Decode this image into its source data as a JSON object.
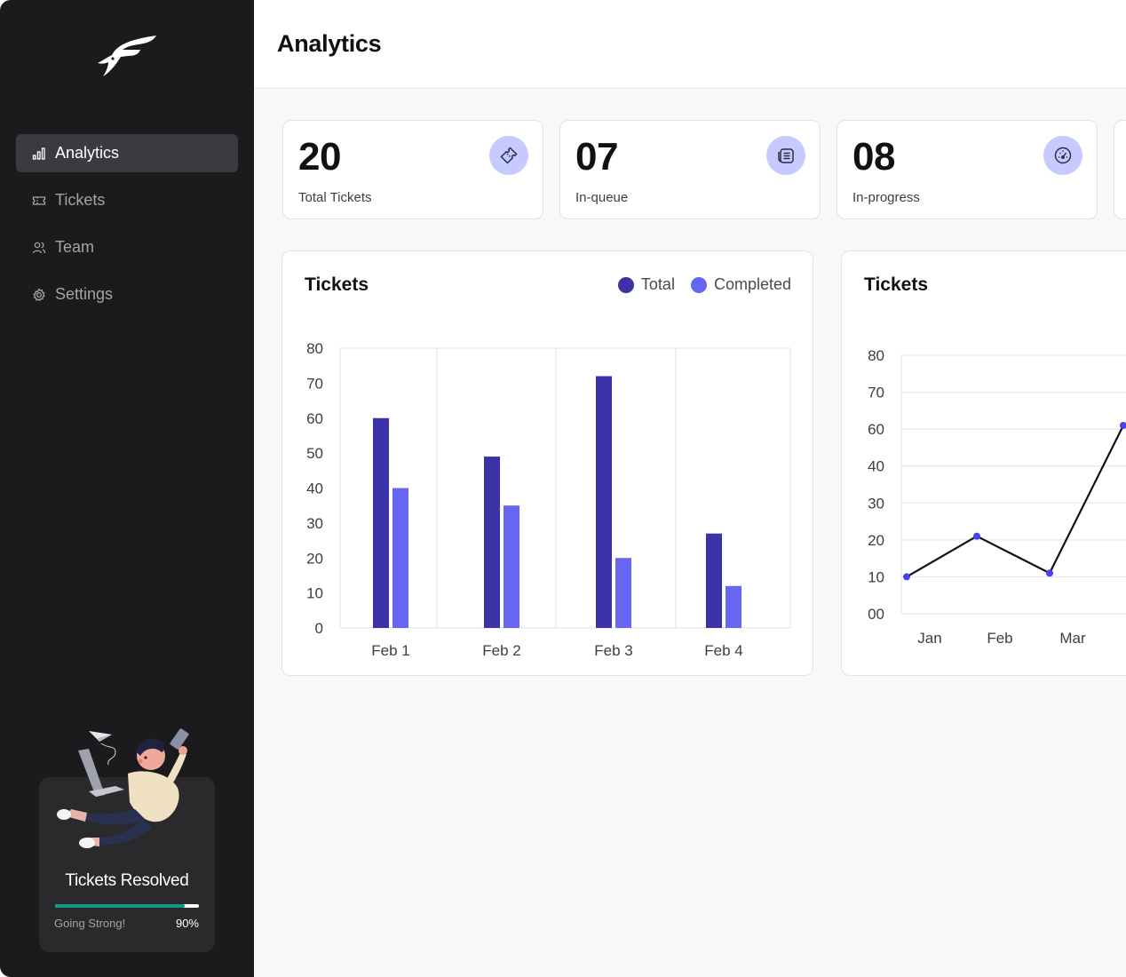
{
  "sidebar": {
    "nav": [
      {
        "label": "Analytics",
        "icon": "bar-chart-icon",
        "active": true
      },
      {
        "label": "Tickets",
        "icon": "ticket-icon",
        "active": false
      },
      {
        "label": "Team",
        "icon": "users-icon",
        "active": false
      },
      {
        "label": "Settings",
        "icon": "gear-icon",
        "active": false
      }
    ],
    "resolved": {
      "title": "Tickets Resolved",
      "status": "Going Strong!",
      "percent_text": "90%",
      "percent": 90
    }
  },
  "header": {
    "title": "Analytics"
  },
  "stats": [
    {
      "value": "20",
      "label": "Total Tickets",
      "icon": "ticket-icon"
    },
    {
      "value": "07",
      "label": "In-queue",
      "icon": "list-icon"
    },
    {
      "value": "08",
      "label": "In-progress",
      "icon": "speedometer-icon"
    }
  ],
  "colors": {
    "total": "#3b32a8",
    "completed": "#6766f0",
    "accent": "#c6cbff",
    "progress": "#14968a"
  },
  "chart_data": [
    {
      "type": "bar",
      "title": "Tickets",
      "categories": [
        "Feb 1",
        "Feb 2",
        "Feb 3",
        "Feb 4"
      ],
      "series": [
        {
          "name": "Total",
          "values": [
            60,
            49,
            72,
            27
          ]
        },
        {
          "name": "Completed",
          "values": [
            40,
            35,
            20,
            12
          ]
        }
      ],
      "yticks": [
        "0",
        "10",
        "20",
        "30",
        "40",
        "50",
        "60",
        "70",
        "80"
      ],
      "ylim": [
        0,
        80
      ],
      "legend": "top-right",
      "grid": "vertical"
    },
    {
      "type": "line",
      "title": "Tickets",
      "categories": [
        "Jan",
        "Feb",
        "Mar"
      ],
      "series": [
        {
          "values": [
            10,
            21,
            11,
            61
          ]
        }
      ],
      "yticks": [
        "00",
        "10",
        "20",
        "30",
        "40",
        "60",
        "70",
        "80"
      ],
      "ylim": [
        0,
        80
      ],
      "grid": "horizontal"
    }
  ]
}
